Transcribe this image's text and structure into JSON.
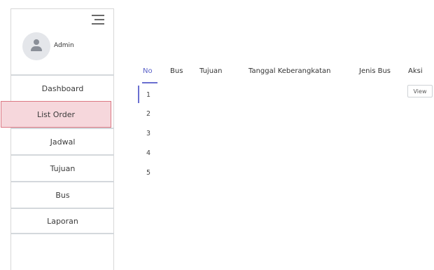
{
  "sidebar": {
    "user_name": "Admin",
    "items": [
      {
        "label": "Dashboard"
      },
      {
        "label": "List Order"
      },
      {
        "label": "Jadwal"
      },
      {
        "label": "Tujuan"
      },
      {
        "label": "Bus"
      },
      {
        "label": "Laporan"
      }
    ]
  },
  "table": {
    "headers": [
      "No",
      "Bus",
      "Tujuan",
      "Tanggal Keberangkatan",
      "Jenis Bus",
      "Aksi"
    ],
    "rows": [
      {
        "no": "1",
        "action": "View"
      },
      {
        "no": "2"
      },
      {
        "no": "3"
      },
      {
        "no": "4"
      },
      {
        "no": "5"
      }
    ]
  },
  "colors": {
    "accent": "#6a6fd0",
    "active_item_bg": "#f6d7dc",
    "active_item_border": "#dc7884"
  }
}
